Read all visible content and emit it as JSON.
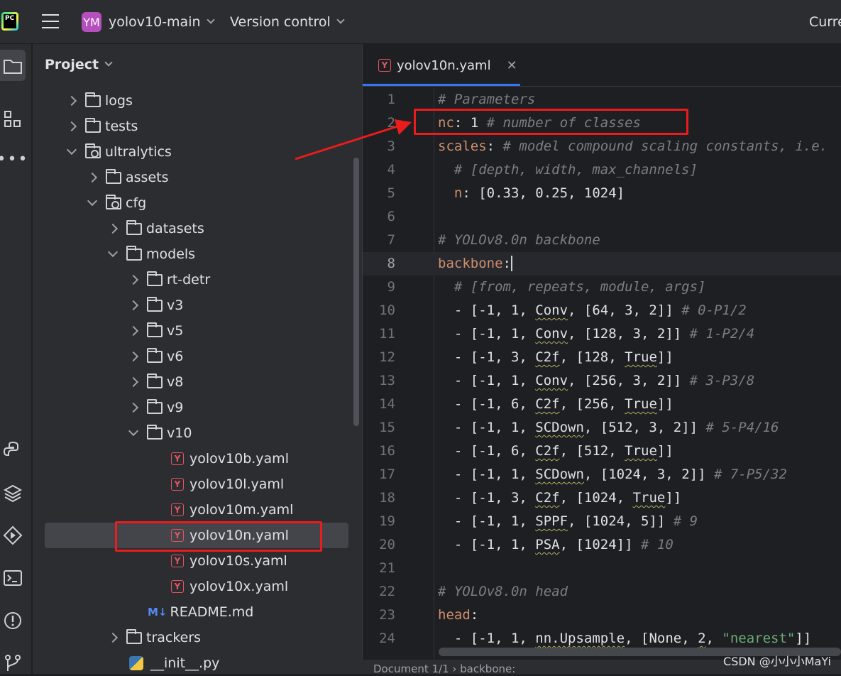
{
  "titlebar": {
    "logo_text": "PC",
    "project_badge": "YM",
    "project_name": "yolov10-main",
    "vcs_label": "Version control",
    "right_text": "Curre"
  },
  "project_panel": {
    "title": "Project",
    "tree": [
      {
        "label": "logs",
        "type": "folder",
        "state": "closed"
      },
      {
        "label": "tests",
        "type": "folder",
        "state": "closed"
      },
      {
        "label": "ultralytics",
        "type": "package",
        "state": "open"
      },
      {
        "label": "assets",
        "type": "folder",
        "state": "closed"
      },
      {
        "label": "cfg",
        "type": "package",
        "state": "open"
      },
      {
        "label": "datasets",
        "type": "folder",
        "state": "closed"
      },
      {
        "label": "models",
        "type": "folder",
        "state": "open"
      },
      {
        "label": "rt-detr",
        "type": "folder",
        "state": "closed"
      },
      {
        "label": "v3",
        "type": "folder",
        "state": "closed"
      },
      {
        "label": "v5",
        "type": "folder",
        "state": "closed"
      },
      {
        "label": "v6",
        "type": "folder",
        "state": "closed"
      },
      {
        "label": "v8",
        "type": "folder",
        "state": "closed"
      },
      {
        "label": "v9",
        "type": "folder",
        "state": "closed"
      },
      {
        "label": "v10",
        "type": "folder",
        "state": "open"
      },
      {
        "label": "yolov10b.yaml",
        "type": "yaml"
      },
      {
        "label": "yolov10l.yaml",
        "type": "yaml"
      },
      {
        "label": "yolov10m.yaml",
        "type": "yaml"
      },
      {
        "label": "yolov10n.yaml",
        "type": "yaml",
        "selected": true
      },
      {
        "label": "yolov10s.yaml",
        "type": "yaml"
      },
      {
        "label": "yolov10x.yaml",
        "type": "yaml"
      },
      {
        "label": "README.md",
        "type": "md"
      },
      {
        "label": "trackers",
        "type": "folder",
        "state": "closed"
      },
      {
        "label": "__init__.py",
        "type": "py"
      }
    ]
  },
  "editor": {
    "tab_label": "yolov10n.yaml",
    "tab_icon": "Y",
    "current_line": 8,
    "lines": [
      {
        "n": "1"
      },
      {
        "n": "2"
      },
      {
        "n": "3"
      },
      {
        "n": "4"
      },
      {
        "n": "5"
      },
      {
        "n": "6"
      },
      {
        "n": "7"
      },
      {
        "n": "8"
      },
      {
        "n": "9"
      },
      {
        "n": "10"
      },
      {
        "n": "11"
      },
      {
        "n": "12"
      },
      {
        "n": "13"
      },
      {
        "n": "14"
      },
      {
        "n": "15"
      },
      {
        "n": "16"
      },
      {
        "n": "17"
      },
      {
        "n": "18"
      },
      {
        "n": "19"
      },
      {
        "n": "20"
      },
      {
        "n": "21"
      },
      {
        "n": "22"
      },
      {
        "n": "23"
      },
      {
        "n": "24"
      }
    ]
  },
  "statusbar": {
    "breadcrumb": "Document 1/1  ›  backbone:"
  },
  "watermark": "CSDN @小小小MaYi",
  "colors": {
    "accent": "#3574f0",
    "annotation": "#ea1c1c",
    "keyword": "#cf8e6d",
    "comment": "#7a7e85",
    "string": "#6aab73"
  }
}
